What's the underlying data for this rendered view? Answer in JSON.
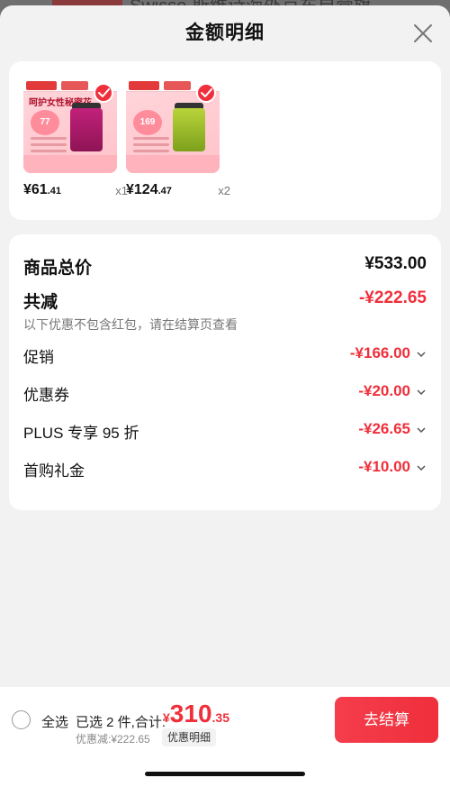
{
  "background": {
    "title_snippet": "Swisse 斯维诗海外京东自营旗…"
  },
  "sheet": {
    "title": "金额明细"
  },
  "products": [
    {
      "headline": "呵护女性秘密花",
      "heart_value": "77",
      "price_int": "¥61",
      "price_dec": ".41",
      "qty": "x1",
      "selected": true
    },
    {
      "headline": "",
      "heart_value": "169",
      "price_int": "¥124",
      "price_dec": ".47",
      "qty": "x2",
      "selected": true
    }
  ],
  "details": {
    "total_label": "商品总价",
    "total_value": "¥533.00",
    "reduce_label": "共减",
    "reduce_value": "-¥222.65",
    "reduce_note": "以下优惠不包含红包，请在结算页查看",
    "discounts": [
      {
        "label": "促销",
        "value": "-¥166.00"
      },
      {
        "label": "优惠券",
        "value": "-¥20.00"
      },
      {
        "label": "PLUS 专享 95 折",
        "value": "-¥26.65"
      },
      {
        "label": "首购礼金",
        "value": "-¥10.00"
      }
    ]
  },
  "bottom": {
    "select_all": "全选",
    "selected_text": "已选 2 件,合计:",
    "total_yen": "¥",
    "total_int": "310",
    "total_dec": ".35",
    "savings": "优惠减:¥222.65",
    "detail_toggle": "优惠明细",
    "checkout": "去结算"
  },
  "colors": {
    "accent": "#ef2f3b",
    "background": "#f2f2f2"
  }
}
